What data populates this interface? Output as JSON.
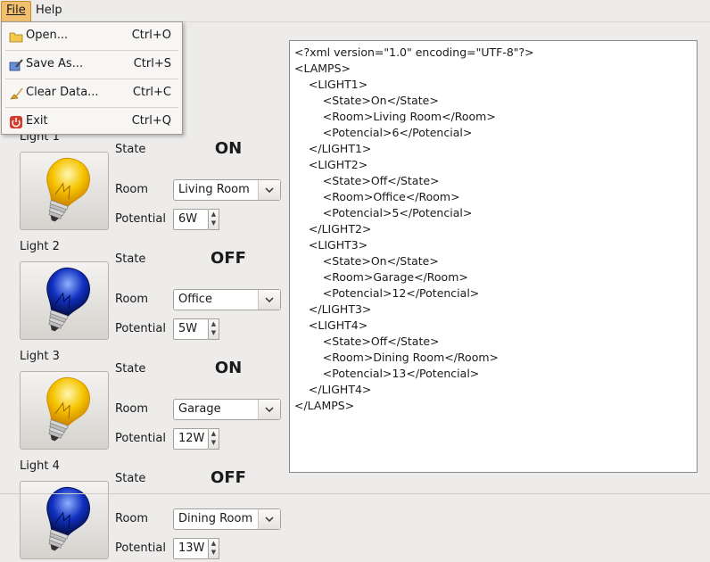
{
  "menubar": {
    "file": "File",
    "help": "Help"
  },
  "file_menu": [
    {
      "icon": "folder-icon",
      "label": "Open...",
      "shortcut": "Ctrl+O"
    },
    {
      "icon": "save-as-icon",
      "label": "Save As...",
      "shortcut": "Ctrl+S"
    },
    {
      "icon": "broom-icon",
      "label": "Clear Data...",
      "shortcut": "Ctrl+C"
    },
    {
      "icon": "power-icon",
      "label": "Exit",
      "shortcut": "Ctrl+Q"
    }
  ],
  "labels": {
    "state": "State",
    "room": "Room",
    "potential": "Potential"
  },
  "lights": [
    {
      "title": "Light 1",
      "state": "ON",
      "room": "Living Room",
      "potential": "6W",
      "bulb": "on"
    },
    {
      "title": "Light 2",
      "state": "OFF",
      "room": "Office",
      "potential": "5W",
      "bulb": "off"
    },
    {
      "title": "Light 3",
      "state": "ON",
      "room": "Garage",
      "potential": "12W",
      "bulb": "on"
    },
    {
      "title": "Light 4",
      "state": "OFF",
      "room": "Dining Room",
      "potential": "13W",
      "bulb": "off"
    }
  ],
  "xml_lines": [
    "<?xml version=\"1.0\" encoding=\"UTF-8\"?>",
    "<LAMPS>",
    "    <LIGHT1>",
    "        <State>On</State>",
    "        <Room>Living Room</Room>",
    "        <Potencial>6</Potencial>",
    "    </LIGHT1>",
    "    <LIGHT2>",
    "        <State>Off</State>",
    "        <Room>Office</Room>",
    "        <Potencial>5</Potencial>",
    "    </LIGHT2>",
    "    <LIGHT3>",
    "        <State>On</State>",
    "        <Room>Garage</Room>",
    "        <Potencial>12</Potencial>",
    "    </LIGHT3>",
    "    <LIGHT4>",
    "        <State>Off</State>",
    "        <Room>Dining Room</Room>",
    "        <Potencial>13</Potencial>",
    "    </LIGHT4>",
    "</LAMPS>"
  ],
  "colors": {
    "bulb_on": "#f5c400",
    "bulb_off": "#1030c0",
    "menu_highlight": "#f0c070"
  }
}
